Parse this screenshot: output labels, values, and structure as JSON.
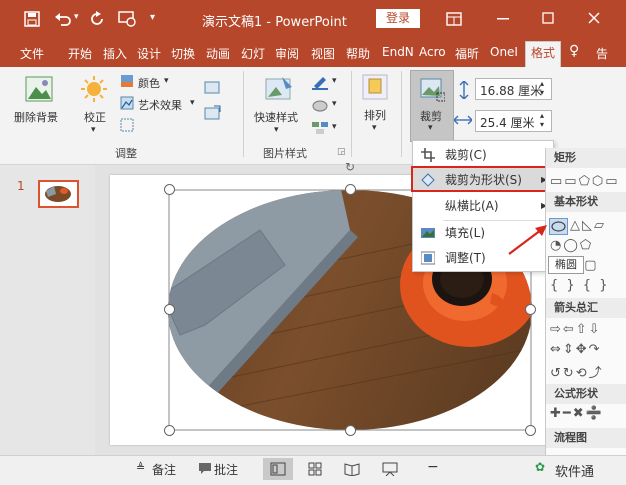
{
  "titlebar": {
    "title": "演示文稿1 - PowerPoint",
    "login": "登录",
    "icons": [
      "save-icon",
      "undo-icon",
      "redo-icon",
      "present-icon",
      "customize-icon",
      "ribbon-display-icon",
      "minimize-icon",
      "restore-icon",
      "close-icon"
    ]
  },
  "tabs": [
    "文件",
    "开始",
    "插入",
    "设计",
    "切换",
    "动画",
    "幻灯",
    "审阅",
    "视图",
    "帮助",
    "EndN",
    "Acro",
    "福昕",
    "OneI",
    "格式",
    "告"
  ],
  "ribbon": {
    "remove_bg": "删除背景",
    "correct": "校正",
    "color": "颜色",
    "art_effects": "艺术效果",
    "adjust_group": "调整",
    "quick_styles": "快速样式",
    "pic_styles_group": "图片样式",
    "arrange": "排列",
    "crop": "裁剪",
    "height_value": "16.88 厘米",
    "width_value": "25.4 厘米"
  },
  "crop_menu": {
    "items": [
      "裁剪(C)",
      "裁剪为形状(S)",
      "纵横比(A)",
      "填充(L)",
      "调整(T)"
    ],
    "highlighted_index": 1
  },
  "shapes_panel": {
    "sections": [
      "矩形",
      "基本形状",
      "箭头总汇",
      "公式形状",
      "流程图"
    ],
    "tooltip": "椭圆"
  },
  "slides": {
    "number": "1"
  },
  "statusbar": {
    "notes": "备注",
    "comments": "批注",
    "watermark": "软件通"
  },
  "colors": {
    "accent": "#b7472a",
    "highlight_border": "#d9261c",
    "arrow": "#d9261c"
  }
}
